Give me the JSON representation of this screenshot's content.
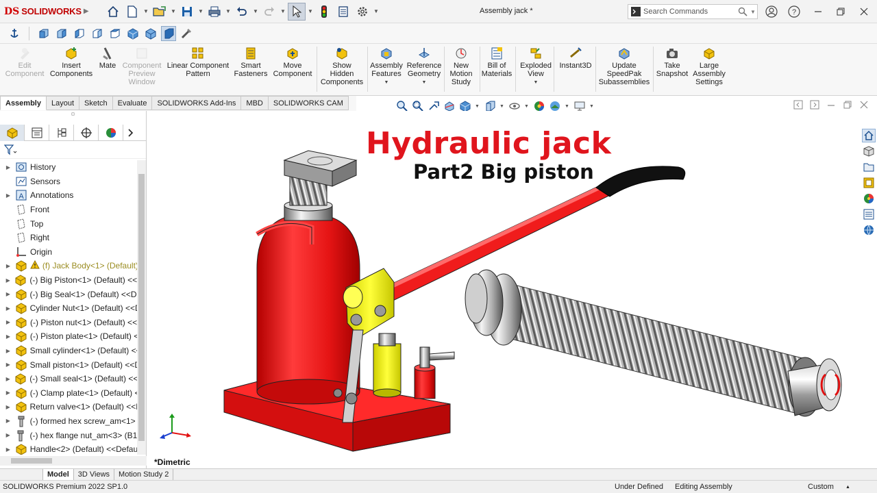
{
  "app": {
    "logo_text": "SOLIDWORKS",
    "logo_mark": "DS",
    "document_title": "Assembly jack *"
  },
  "quick_access": {
    "icons": [
      "home-icon",
      "new-document-icon",
      "open-icon",
      "save-icon",
      "print-icon",
      "undo-icon",
      "redo-icon",
      "select-pointer-icon",
      "rebuild-icon",
      "file-properties-icon",
      "options-gear-icon"
    ]
  },
  "search": {
    "placeholder": "Search Commands"
  },
  "command_manager": {
    "commands": [
      {
        "id": "edit-component",
        "label1": "Edit",
        "label2": "Component",
        "label3": "",
        "enabled": false
      },
      {
        "id": "insert-components",
        "label1": "Insert",
        "label2": "Components",
        "label3": "",
        "enabled": true
      },
      {
        "id": "mate",
        "label1": "Mate",
        "label2": "",
        "label3": "",
        "enabled": true
      },
      {
        "id": "component-preview-window",
        "label1": "Component",
        "label2": "Preview",
        "label3": "Window",
        "enabled": false
      },
      {
        "id": "linear-component-pattern",
        "label1": "Linear Component",
        "label2": "Pattern",
        "label3": "",
        "enabled": true
      },
      {
        "id": "smart-fasteners",
        "label1": "Smart",
        "label2": "Fasteners",
        "label3": "",
        "enabled": true
      },
      {
        "id": "move-component",
        "label1": "Move",
        "label2": "Component",
        "label3": "",
        "enabled": true
      },
      {
        "id": "show-hidden-components",
        "label1": "Show",
        "label2": "Hidden",
        "label3": "Components",
        "enabled": true
      },
      {
        "id": "assembly-features",
        "label1": "Assembly",
        "label2": "Features",
        "label3": "",
        "enabled": true
      },
      {
        "id": "reference-geometry",
        "label1": "Reference",
        "label2": "Geometry",
        "label3": "",
        "enabled": true
      },
      {
        "id": "new-motion-study",
        "label1": "New",
        "label2": "Motion",
        "label3": "Study",
        "enabled": true
      },
      {
        "id": "bill-of-materials",
        "label1": "Bill of",
        "label2": "Materials",
        "label3": "",
        "enabled": true
      },
      {
        "id": "exploded-view",
        "label1": "Exploded",
        "label2": "View",
        "label3": "",
        "enabled": true
      },
      {
        "id": "instant3d",
        "label1": "Instant3D",
        "label2": "",
        "label3": "",
        "enabled": true
      },
      {
        "id": "update-speedpak",
        "label1": "Update",
        "label2": "SpeedPak",
        "label3": "Subassemblies",
        "enabled": true
      },
      {
        "id": "take-snapshot",
        "label1": "Take",
        "label2": "Snapshot",
        "label3": "",
        "enabled": true
      },
      {
        "id": "large-assembly-settings",
        "label1": "Large",
        "label2": "Assembly",
        "label3": "Settings",
        "enabled": true
      }
    ]
  },
  "tabs": [
    "Assembly",
    "Layout",
    "Sketch",
    "Evaluate",
    "SOLIDWORKS Add-Ins",
    "MBD",
    "SOLIDWORKS CAM"
  ],
  "feature_tree": {
    "nodes": [
      {
        "label": "History",
        "icon": "history-icon",
        "expandable": true
      },
      {
        "label": "Sensors",
        "icon": "sensors-icon",
        "expandable": false
      },
      {
        "label": "Annotations",
        "icon": "annotations-icon",
        "expandable": true
      },
      {
        "label": "Front",
        "icon": "plane-icon",
        "expandable": false
      },
      {
        "label": "Top",
        "icon": "plane-icon",
        "expandable": false
      },
      {
        "label": "Right",
        "icon": "plane-icon",
        "expandable": false
      },
      {
        "label": "Origin",
        "icon": "origin-icon",
        "expandable": false
      },
      {
        "label": "(f) Jack Body<1> (Default)",
        "icon": "part-icon",
        "expandable": true,
        "warning": true
      },
      {
        "label": "(-) Big Piston<1> (Default) <<D",
        "icon": "part-icon",
        "expandable": true
      },
      {
        "label": "(-) Big Seal<1> (Default) <<De",
        "icon": "part-icon",
        "expandable": true
      },
      {
        "label": "Cylinder Nut<1> (Default) <<D",
        "icon": "part-icon",
        "expandable": true
      },
      {
        "label": "(-) Piston nut<1> (Default) <<",
        "icon": "part-icon",
        "expandable": true
      },
      {
        "label": "(-) Piston plate<1> (Default) <",
        "icon": "part-icon",
        "expandable": true
      },
      {
        "label": "Small cylinder<1> (Default) <<",
        "icon": "part-icon",
        "expandable": true
      },
      {
        "label": "Small piston<1> (Default) <<D",
        "icon": "part-icon",
        "expandable": true
      },
      {
        "label": "(-) Small seal<1> (Default) <<D",
        "icon": "part-icon",
        "expandable": true
      },
      {
        "label": "(-) Clamp plate<1> (Default) <",
        "icon": "part-icon",
        "expandable": true
      },
      {
        "label": "Return valve<1> (Default) <<D",
        "icon": "part-icon",
        "expandable": true
      },
      {
        "label": "(-) formed hex screw_am<1> (",
        "icon": "screw-icon",
        "expandable": true
      },
      {
        "label": "(-) hex flange nut_am<3> (B18",
        "icon": "screw-icon",
        "expandable": true
      },
      {
        "label": "Handle<2> (Default) <<Defaul",
        "icon": "part-icon",
        "expandable": true
      }
    ]
  },
  "viewport": {
    "title_main": "Hydraulic jack",
    "title_sub": "Part2 Big piston",
    "view_orientation": "*Dimetric"
  },
  "bottom_tabs": [
    "Model",
    "3D Views",
    "Motion Study 2"
  ],
  "status_bar": {
    "product": "SOLIDWORKS Premium 2022 SP1.0",
    "definition": "Under Defined",
    "mode": "Editing Assembly",
    "units": "Custom"
  },
  "colors": {
    "accent_red": "#e0151d",
    "body_red": "#f01c1c",
    "clamp_yellow": "#f2f012",
    "handle_black": "#111111"
  }
}
